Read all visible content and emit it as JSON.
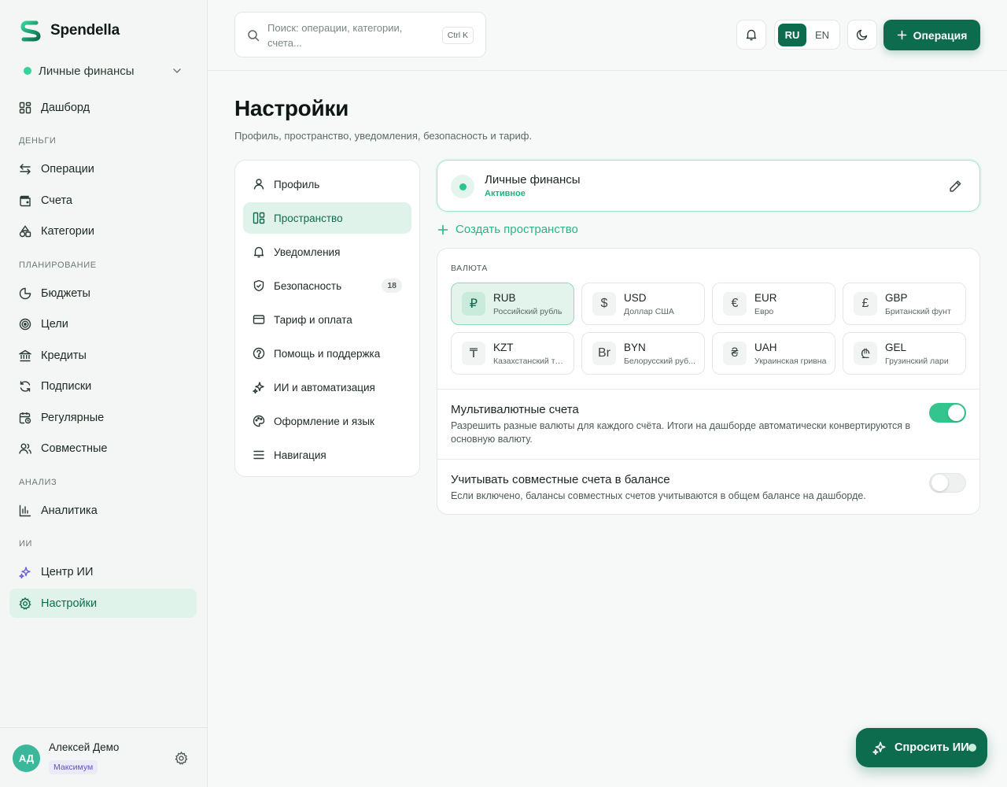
{
  "app": {
    "name": "Spendella",
    "colors": {
      "primary": "#0d6b4e",
      "accent": "#34d399"
    }
  },
  "sidebar": {
    "space": "Личные финансы",
    "items": [
      {
        "label": "Дашборд",
        "icon": "dashboard-icon"
      },
      {
        "section": "ДЕНЬГИ"
      },
      {
        "label": "Операции",
        "icon": "transfer-icon"
      },
      {
        "label": "Счета",
        "icon": "wallet-icon"
      },
      {
        "label": "Категории",
        "icon": "shapes-icon"
      },
      {
        "section": "ПЛАНИРОВАНИЕ"
      },
      {
        "label": "Бюджеты",
        "icon": "pie-icon"
      },
      {
        "label": "Цели",
        "icon": "target-icon"
      },
      {
        "label": "Кредиты",
        "icon": "bank-icon"
      },
      {
        "label": "Подписки",
        "icon": "refresh-icon"
      },
      {
        "label": "Регулярные",
        "icon": "calendar-clock-icon"
      },
      {
        "label": "Совместные",
        "icon": "users-icon"
      },
      {
        "section": "АНАЛИЗ"
      },
      {
        "label": "Аналитика",
        "icon": "bar-chart-icon"
      },
      {
        "section": "ИИ"
      },
      {
        "label": "Центр ИИ",
        "icon": "sparkles-icon"
      },
      {
        "label": "Настройки",
        "icon": "gear-icon",
        "active": true
      }
    ],
    "user": {
      "initials": "АД",
      "name": "Алексей Демо",
      "plan": "Максимум"
    }
  },
  "topbar": {
    "search_placeholder": "Поиск: операции, категории, счета...",
    "search_shortcut": "Ctrl K",
    "languages": [
      "RU",
      "EN"
    ],
    "active_language": "RU",
    "new_operation": "Операция"
  },
  "page": {
    "title": "Настройки",
    "subtitle": "Профиль, пространство, уведомления, безопасность и тариф."
  },
  "settings_menu": [
    {
      "label": "Профиль",
      "icon": "user-icon"
    },
    {
      "label": "Пространство",
      "icon": "layout-icon",
      "active": true
    },
    {
      "label": "Уведомления",
      "icon": "bell-icon"
    },
    {
      "label": "Безопасность",
      "icon": "shield-icon",
      "badge": "18"
    },
    {
      "label": "Тариф и оплата",
      "icon": "credit-card-icon"
    },
    {
      "label": "Помощь и поддержка",
      "icon": "help-icon"
    },
    {
      "label": "ИИ и автоматизация",
      "icon": "sparkles-icon"
    },
    {
      "label": "Оформление и язык",
      "icon": "palette-icon"
    },
    {
      "label": "Навигация",
      "icon": "menu-icon"
    }
  ],
  "space_card": {
    "name": "Личные финансы",
    "status": "Активное",
    "create_label": "Создать пространство"
  },
  "currency": {
    "label": "ВАЛЮТА",
    "selected": "RUB",
    "options": [
      {
        "symbol": "₽",
        "code": "RUB",
        "name": "Российский рубль"
      },
      {
        "symbol": "$",
        "code": "USD",
        "name": "Доллар США"
      },
      {
        "symbol": "€",
        "code": "EUR",
        "name": "Евро"
      },
      {
        "symbol": "£",
        "code": "GBP",
        "name": "Британский фунт"
      },
      {
        "symbol": "₸",
        "code": "KZT",
        "name": "Казахстанский те..."
      },
      {
        "symbol": "Br",
        "code": "BYN",
        "name": "Белорусский руб..."
      },
      {
        "symbol": "₴",
        "code": "UAH",
        "name": "Украинская гривна"
      },
      {
        "symbol": "₾",
        "code": "GEL",
        "name": "Грузинский лари"
      }
    ]
  },
  "options": {
    "multicurrency": {
      "title": "Мультивалютные счета",
      "desc": "Разрешить разные валюты для каждого счёта. Итоги на дашборде автоматически конвертируются в основную валюту.",
      "enabled": true
    },
    "shared_balance": {
      "title": "Учитывать совместные счета в балансе",
      "desc": "Если включено, балансы совместных счетов учитываются в общем балансе на дашборде.",
      "enabled": false
    }
  },
  "ai_button": {
    "label": "Спросить ИИ"
  }
}
